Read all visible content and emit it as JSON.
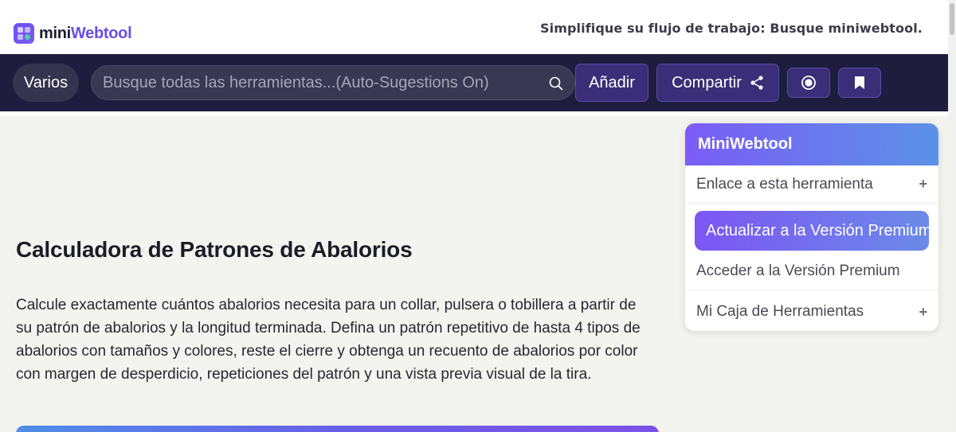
{
  "header": {
    "logo_text_1": "mini",
    "logo_text_2": "Webtool",
    "tagline": "Simplifique su flujo de trabajo: Busque miniwebtool."
  },
  "nav": {
    "categories_label": "Varios",
    "search_placeholder": "Busque todas las herramientas...(Auto-Sugestions On)",
    "add_label": "Añadir",
    "share_label": "Compartir",
    "icons": [
      "search-icon",
      "share-icon",
      "record-icon",
      "bookmark-icon"
    ]
  },
  "main": {
    "title": "Calculadora de Patrones de Abalorios",
    "description": "Calcule exactamente cuántos abalorios necesita para un collar, pulsera o tobillera a partir de su patrón de abalorios y la longitud terminada. Defina un patrón repetitivo de hasta 4 tipos de abalorios con tamaños y colores, reste el cierre y obtenga un recuento de abalorios por color con margen de desperdicio, repeticiones del patrón y una vista previa visual de la tira."
  },
  "sidebar": {
    "title": "MiniWebtool",
    "link_label": "Enlace a esta herramienta",
    "upgrade_label": "Actualizar a la Versión Premium",
    "access_label": "Acceder a la Versión Premium",
    "toolbox_label": "Mi Caja de Herramientas",
    "expand_symbol": "+"
  },
  "colors": {
    "nav_bg": "#1f1d3d",
    "accent": "#6b4ee6",
    "page_bg": "#f3f3ef"
  }
}
